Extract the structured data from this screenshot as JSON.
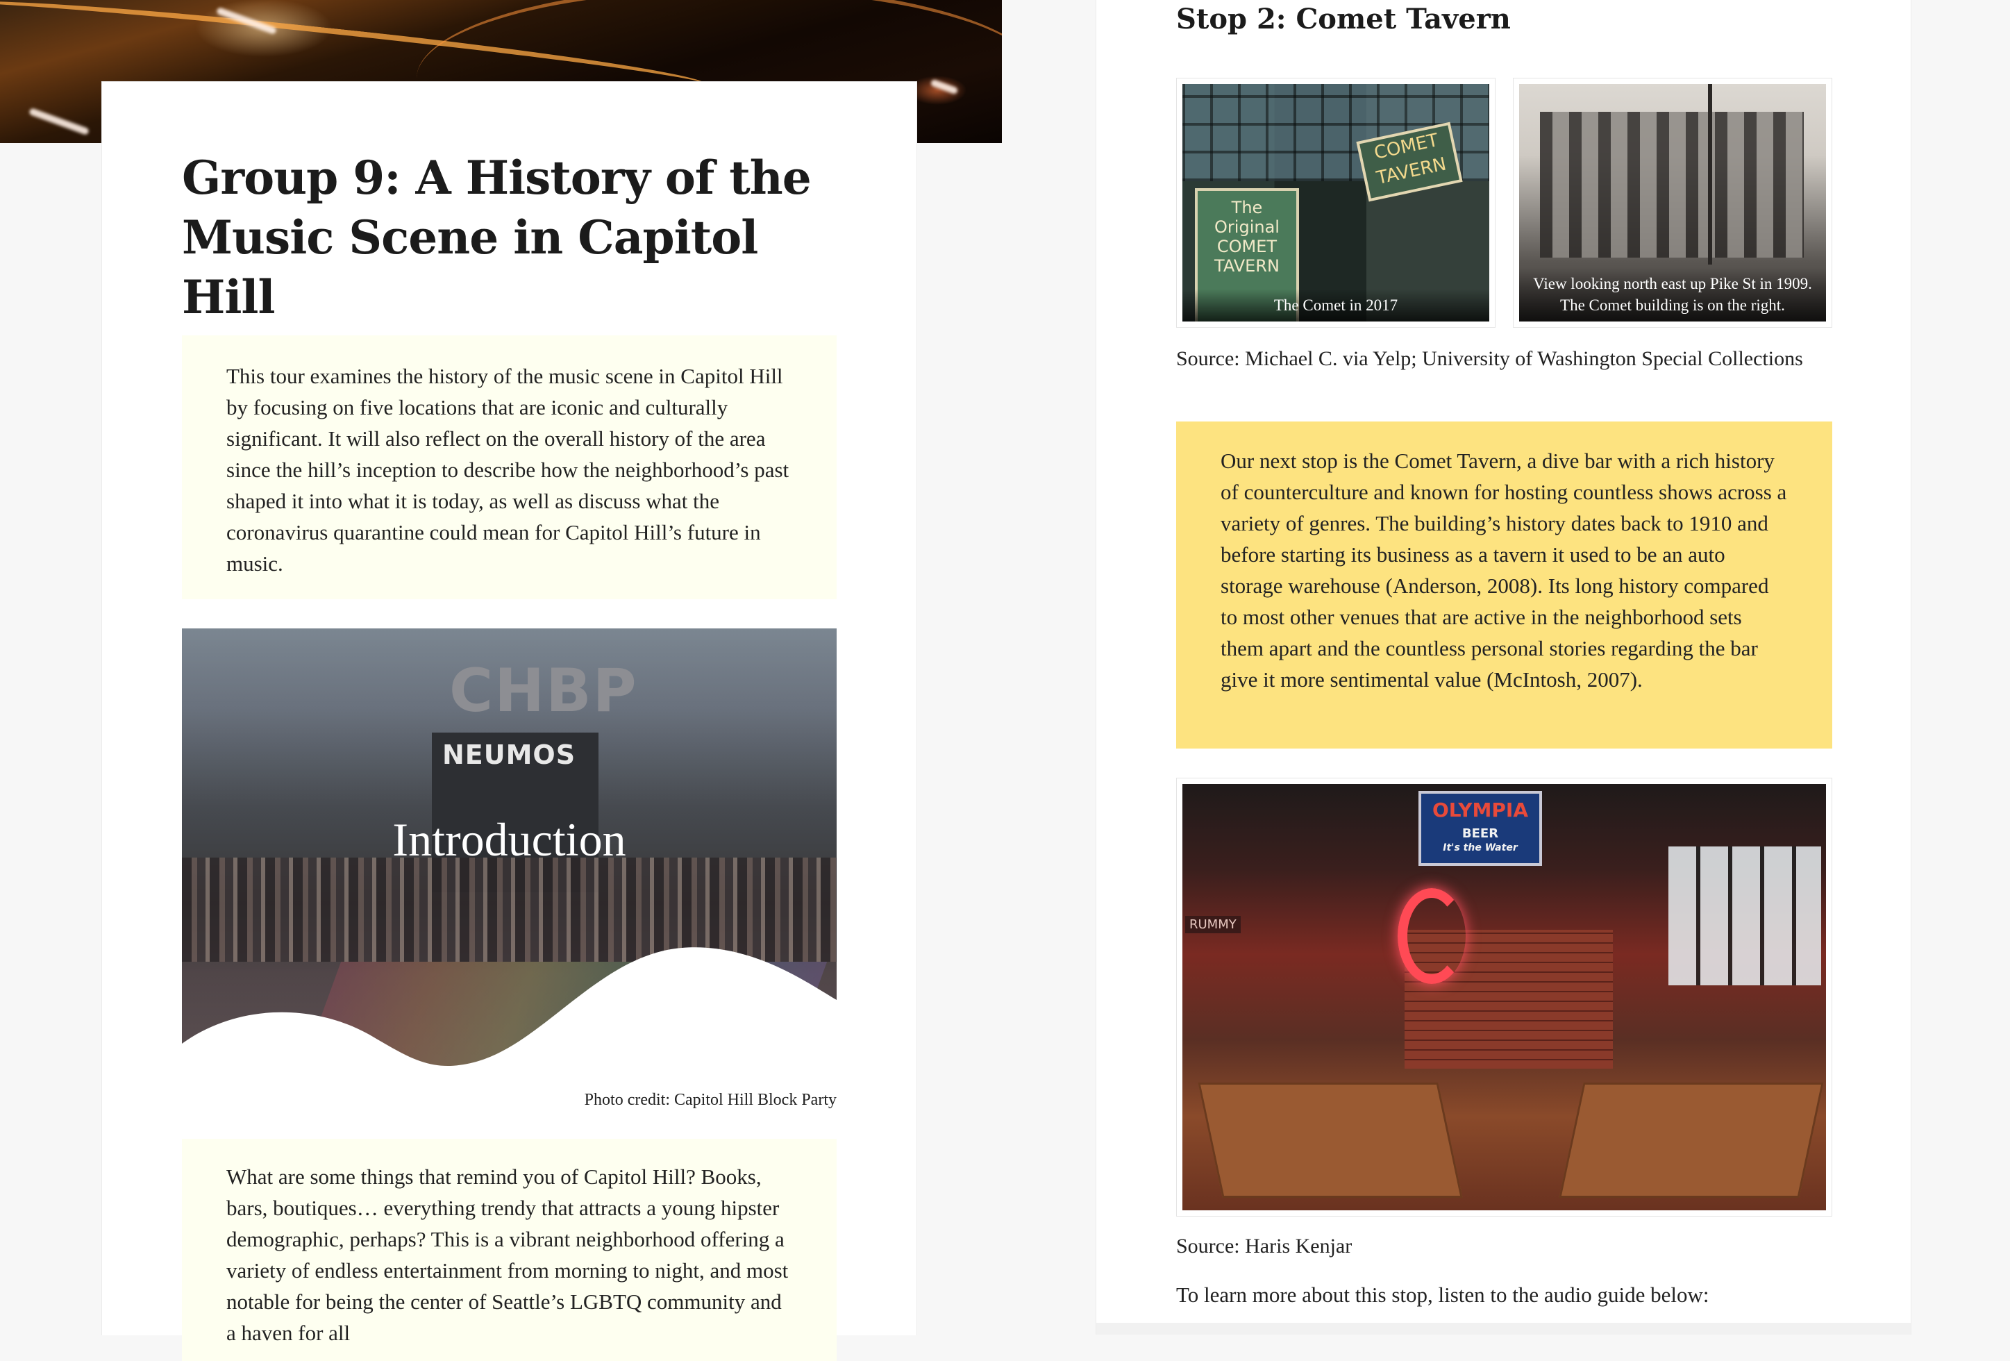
{
  "left": {
    "title": "Group 9: A History of the Music Scene in Capitol Hill",
    "intro_text": "This tour examines the history of the music scene in Capitol Hill by focusing on five locations that are iconic and culturally significant. It will also reflect on the overall history of the area since the hill’s inception to describe how the neighborhood’s past shaped it into what it is today, as well as discuss what the coronavirus quarantine could mean for Capitol Hill’s future in music.",
    "intro_image": {
      "label": "Introduction",
      "sign_text": "NEUMOS",
      "letters_text": "CHBP"
    },
    "photo_credit_prefix": "Photo credit: ",
    "photo_credit_link": "Capitol Hill Block Party",
    "second_text": "What are some things that remind you of Capitol Hill? Books, bars, boutiques… everything trendy that attracts a young hipster demographic, perhaps? This is a vibrant neighborhood offering a variety of endless entertainment from morning to night, and most notable for being the center of Seattle’s LGBTQ community and a haven for all"
  },
  "right": {
    "stop_title": "Stop 2: Comet Tavern",
    "gallery": [
      {
        "caption": "The Comet in 2017",
        "neon_text": "COMET TAVERN",
        "board_text": "The Original COMET TAVERN"
      },
      {
        "caption": "View looking north east up Pike St in 1909. The Comet building is on the right."
      }
    ],
    "gallery_source": "Source: Michael C. via Yelp; University of Washington Special Collections",
    "stop_text": "Our next stop is the Comet Tavern, a dive bar with a rich history of counterculture and known for hosting countless shows across a variety of genres. The building’s history dates back to 1910 and before starting its business as a tavern it used to be an auto storage warehouse (Anderson, 2008). Its long history compared to most other venues that are active in the neighborhood sets them apart and the countless personal stories regarding the bar give it more sentimental value (McIntosh, 2007).",
    "interior_image": {
      "sign_main": "OLYMPIA",
      "sign_sub": "BEER",
      "sign_tag": "It's the Water",
      "small_sign": "RUMMY"
    },
    "interior_source": "Source: Haris Kenjar",
    "audio_note": "To learn more about this stop, listen to the audio guide below:"
  },
  "colors": {
    "cream_box": "#fefff0",
    "yellow_box": "#fde380",
    "page_bg": "#f7f7f7"
  }
}
